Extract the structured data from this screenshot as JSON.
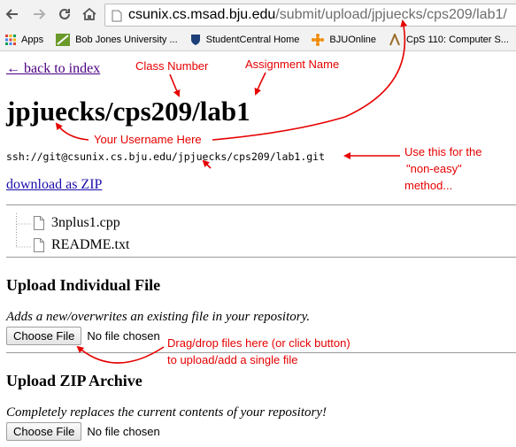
{
  "browser": {
    "url_host": "csunix.cs.msad.bju.edu",
    "url_path": "/submit/upload/jpjuecks/cps209/lab1/",
    "bookmarks": [
      {
        "label": "Apps",
        "icon": "apps-grid-icon"
      },
      {
        "label": "Bob Jones University ...",
        "icon": "bju-shield-icon"
      },
      {
        "label": "StudentCentral Home",
        "icon": "studentcentral-shield-icon"
      },
      {
        "label": "BJUOnline",
        "icon": "bjuonline-icon"
      },
      {
        "label": "CpS 110: Computer S...",
        "icon": "cps-bookmark-icon"
      }
    ]
  },
  "page": {
    "back_link": "← back to index",
    "title": "jpjuecks/cps209/lab1",
    "ssh_url": "ssh://git@csunix.cs.bju.edu/jpjuecks/cps209/lab1.git",
    "download_link": "download as ZIP",
    "files": [
      "3nplus1.cpp",
      "README.txt"
    ],
    "upload_file": {
      "heading": "Upload Individual File",
      "description": "Adds a new/overwrites an existing file in your repository.",
      "button": "Choose File",
      "status": "No file chosen"
    },
    "upload_zip": {
      "heading": "Upload ZIP Archive",
      "description": "Completely replaces the current contents of your repository!",
      "button": "Choose File",
      "status": "No file chosen"
    }
  },
  "annotations": {
    "class_number": "Class Number",
    "assignment_name": "Assignment Name",
    "username": "Your Username Here",
    "non_easy_line1": "Use this for the",
    "non_easy_line2": "\"non-easy\"",
    "non_easy_line3": "method...",
    "dragdrop_line1": "Drag/drop files here (or click button)",
    "dragdrop_line2": "to upload/add a single file"
  },
  "colors": {
    "annotation": "#e60000",
    "link": "#1a0dab",
    "visited_link": "#4b0082"
  }
}
